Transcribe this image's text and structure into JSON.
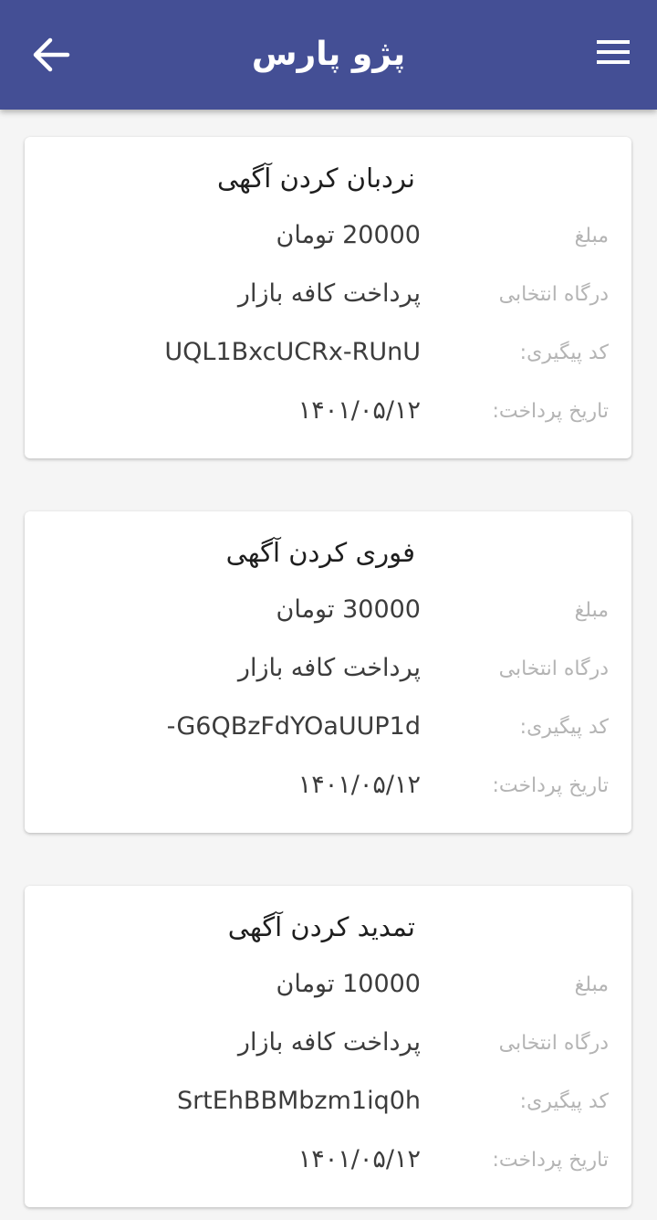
{
  "header": {
    "title": "پژو پارس",
    "back_icon": "arrow-left-icon",
    "menu_icon": "hamburger-menu-icon",
    "background": "#444f95"
  },
  "labels": {
    "amount": "مبلغ",
    "gateway": "درگاه انتخابی",
    "tracking_code": "کد پیگیری:",
    "payment_date": "تاریخ پرداخت:"
  },
  "payments": [
    {
      "title": "نردبان کردن آگهی",
      "amount": "20000 تومان",
      "gateway": "پرداخت کافه بازار",
      "tracking_code": "UQL1BxcUCRx-RUnU",
      "date": "۱۴۰۱/۰۵/۱۲"
    },
    {
      "title": "فوری کردن آگهی",
      "amount": "30000 تومان",
      "gateway": "پرداخت کافه بازار",
      "tracking_code": "-G6QBzFdYOaUUP1d",
      "date": "۱۴۰۱/۰۵/۱۲"
    },
    {
      "title": "تمدید کردن آگهی",
      "amount": "10000 تومان",
      "gateway": "پرداخت کافه بازار",
      "tracking_code": "SrtEhBBMbzm1iq0h",
      "date": "۱۴۰۱/۰۵/۱۲"
    }
  ]
}
